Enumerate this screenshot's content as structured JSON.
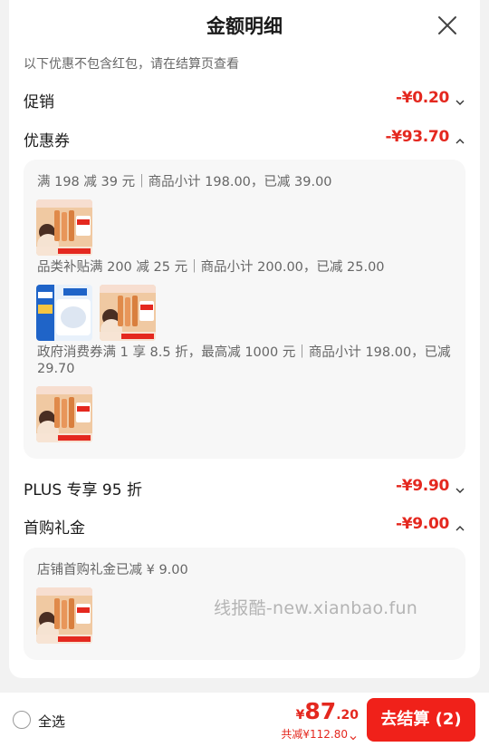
{
  "header": {
    "title": "金额明细"
  },
  "note": "以下优惠不包含红包，请在结算页查看",
  "rows": [
    {
      "label": "促销",
      "amount": "-¥0.20",
      "expanded": false
    },
    {
      "label": "优惠券",
      "amount": "-¥93.70",
      "expanded": true
    },
    {
      "label": "PLUS 专享 95 折",
      "amount": "-¥9.90",
      "expanded": false
    },
    {
      "label": "首购礼金",
      "amount": "-¥9.00",
      "expanded": true
    }
  ],
  "coupons": [
    {
      "text": "满 198 减 39 元｜商品小计 198.00，已减 39.00",
      "products": [
        "haircare-set"
      ]
    },
    {
      "text": "品类补贴满 200 减 25 元｜商品小计 200.00，已减 25.00",
      "products": [
        "tissue-pack",
        "haircare-set"
      ]
    },
    {
      "text": "政府消费券满 1 享 8.5 折，最高减 1000 元｜商品小计 198.00，已减 29.70",
      "products": [
        "haircare-set"
      ]
    }
  ],
  "gift": {
    "text": "店铺首购礼金已减 ¥ 9.00",
    "products": [
      "haircare-set"
    ]
  },
  "watermark": "线报酷-new.xianbao.fun",
  "footer": {
    "select_all": "全选",
    "total_yen": "¥",
    "total_int": "87",
    "total_dec": ".20",
    "saved": "共减¥112.80",
    "checkout": "去结算 (2)"
  },
  "colors": {
    "accent": "#e4281f",
    "button": "#f0211a"
  },
  "icons": {
    "close": "close-icon",
    "collapse": "chevron-up-icon",
    "expand": "chevron-down-icon"
  }
}
